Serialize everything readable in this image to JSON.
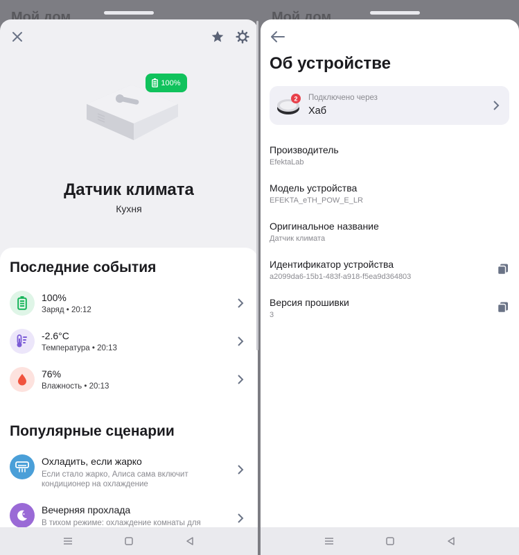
{
  "left_panel": {
    "header_peek": "Мой дом",
    "battery_badge": "100%",
    "device_name": "Датчик климата",
    "room": "Кухня",
    "events_title": "Последние события",
    "events": [
      {
        "value": "100%",
        "detail": "Заряд • 20:12",
        "icon": "battery-icon",
        "color": "#17b45a",
        "bg": "#dff5e7"
      },
      {
        "value": "-2.6°C",
        "detail": "Температура • 20:13",
        "icon": "thermometer-icon",
        "color": "#7b5bd6",
        "bg": "#ece6fa"
      },
      {
        "value": "76%",
        "detail": "Влажность • 20:13",
        "icon": "drop-icon",
        "color": "#f0533e",
        "bg": "#fde2de"
      }
    ],
    "scenarios_title": "Популярные сценарии",
    "scenarios": [
      {
        "title": "Охладить, если жарко",
        "desc": "Если стало жарко, Алиса сама включит кондиционер на охлаждение",
        "icon": "air-conditioner-icon",
        "color": "#4a9fd8"
      },
      {
        "title": "Вечерняя прохлада",
        "desc": "В тихом режиме: охлаждение комнаты для комфортного сна",
        "icon": "moon-icon",
        "color": "#9a6ad6"
      }
    ]
  },
  "right_panel": {
    "header_peek": "Мой дом",
    "title": "Об устройстве",
    "hub": {
      "label": "Подключено через",
      "name": "Хаб",
      "badge": "2"
    },
    "info": [
      {
        "key": "Производитель",
        "value": "EfektaLab",
        "copy": false
      },
      {
        "key": "Модель устройства",
        "value": "EFEKTA_eTH_POW_E_LR",
        "copy": false
      },
      {
        "key": "Оригинальное название",
        "value": "Датчик климата",
        "copy": false
      },
      {
        "key": "Идентификатор устройства",
        "value": "a2099da6-15b1-483f-a918-f5ea9d364803",
        "copy": true
      },
      {
        "key": "Версия прошивки",
        "value": "3",
        "copy": true
      }
    ]
  },
  "colors": {
    "accent_green": "#10c25c",
    "icon_gray": "#5a6275"
  }
}
